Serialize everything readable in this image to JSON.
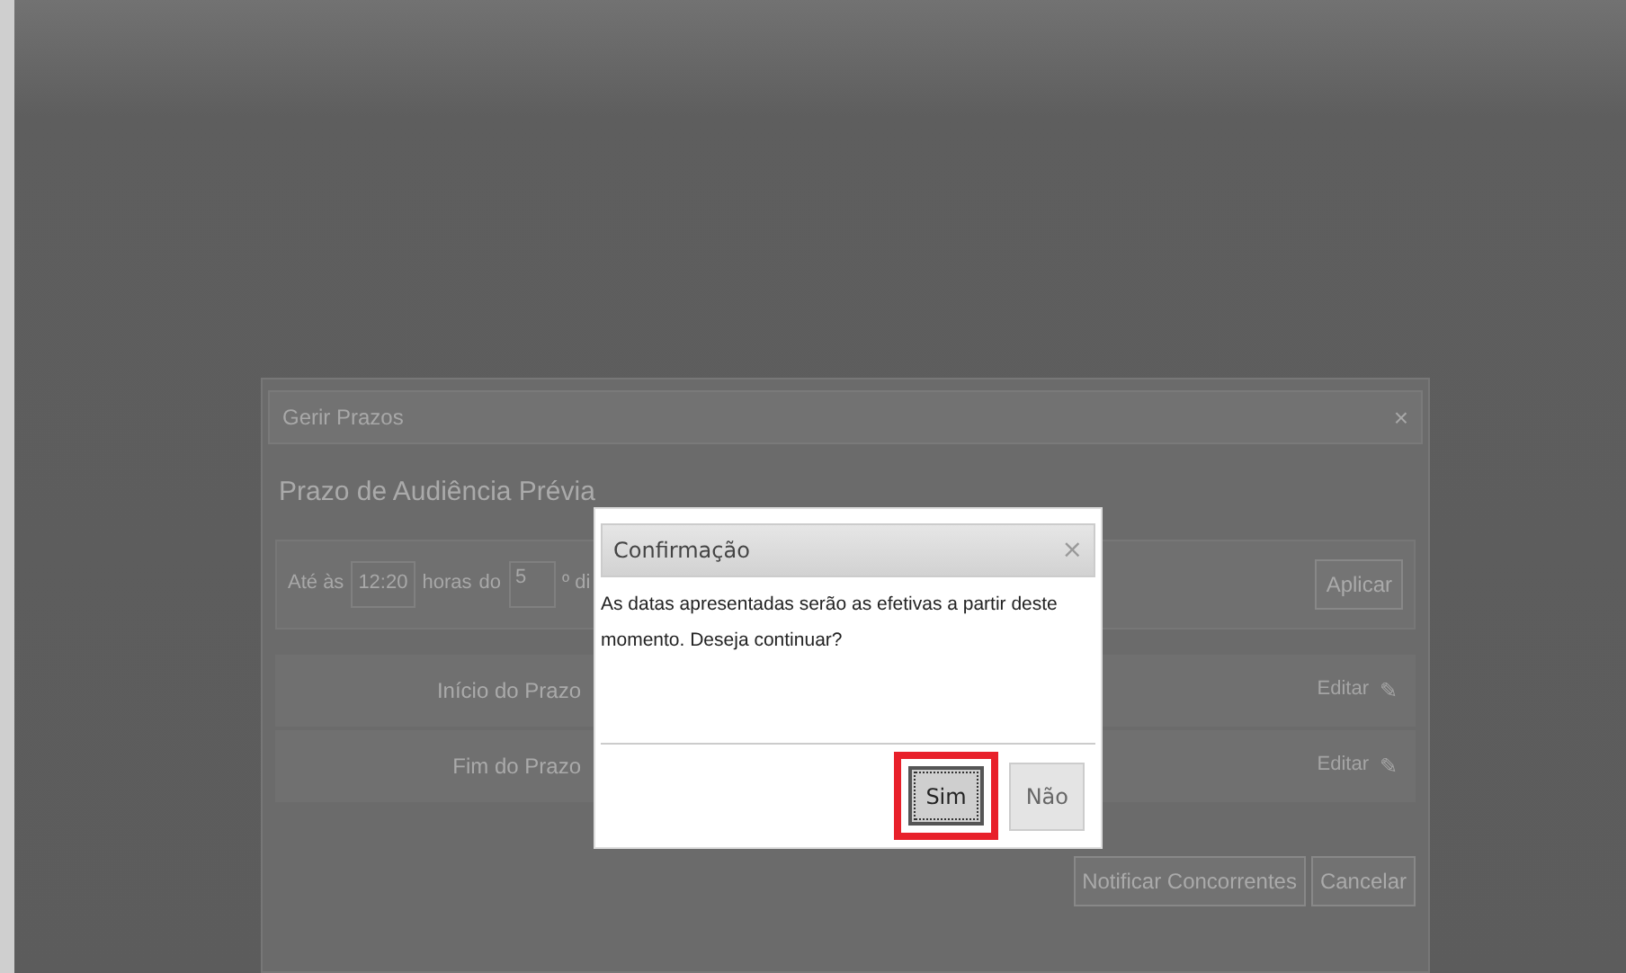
{
  "panel": {
    "title": "Gerir Prazos",
    "close": "×",
    "heading": "Prazo de Audiência Prévia",
    "filter": {
      "prefix": "Até às",
      "time": "12:20",
      "hours_label": "horas",
      "day_prefix": "do",
      "day": "5",
      "cut_text": "º di",
      "apply": "Aplicar"
    },
    "rows": [
      {
        "label": "Início do Prazo",
        "action": "Editar",
        "icon": "✎"
      },
      {
        "label": "Fim do Prazo",
        "action": "Editar",
        "icon": "✎"
      }
    ],
    "buttons": [
      "Notificar Concorrentes",
      "Cancelar"
    ]
  },
  "dialog": {
    "title": "Confirmação",
    "close": "×",
    "message": "As datas apresentadas serão as efetivas a partir deste momento. Deseja continuar?",
    "buttons": [
      {
        "label": "Sim",
        "focused": true,
        "highlighted": true
      },
      {
        "label": "Não",
        "focused": false,
        "highlighted": false
      }
    ]
  }
}
